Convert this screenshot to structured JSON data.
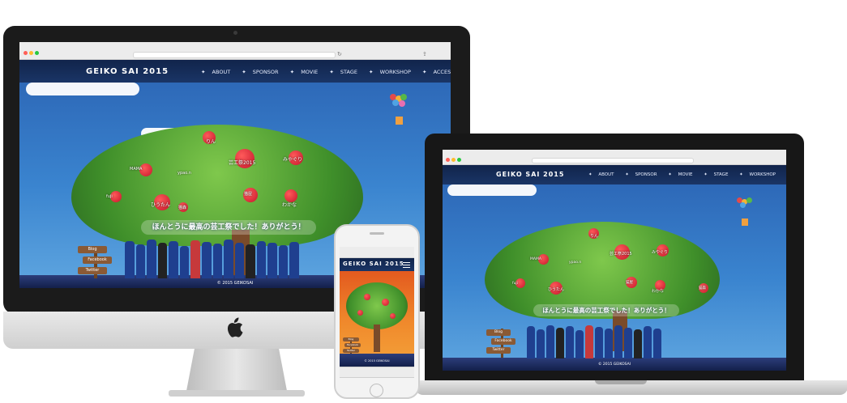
{
  "site": {
    "logo_main": "GEIKO SAI",
    "logo_o": "O",
    "logo_year": "2015",
    "menu": [
      "ABOUT",
      "SPONSOR",
      "MOVIE",
      "STAGE",
      "WORKSHOP",
      "ACCESS"
    ],
    "menu_bullet": "✦",
    "banner": "ほんとうに最高の芸工祭でした！ありがとう！",
    "apple_tags": [
      "りん",
      "MAMA",
      "芸工祭2015",
      "みやぐり",
      "ypao.n",
      "fuji",
      "ひうたん",
      "猫屋",
      "わかな",
      "猫森"
    ],
    "signs": [
      "Blog",
      "Facebook",
      "Twitter"
    ],
    "copyright": "© 2015 GEIKOSAI"
  },
  "colors": {
    "nav": "#1a3566",
    "sky": "#3a84cf",
    "accent_red": "#e23a3a",
    "phone_sky": "#f08a2c"
  },
  "icons": {
    "apple_logo": "apple-logo-icon",
    "menu_toggle": "hamburger-icon",
    "share": "share-icon",
    "reload": "reload-icon"
  }
}
